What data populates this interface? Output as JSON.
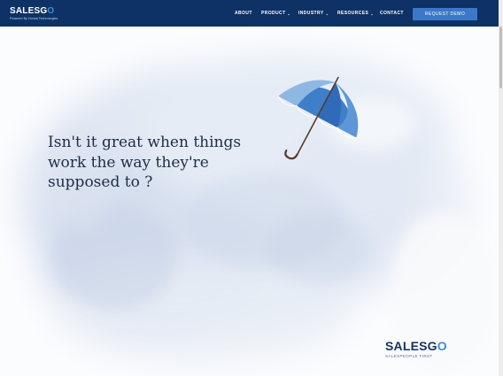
{
  "header": {
    "logo": {
      "brand_main": "SALESG",
      "brand_o": "O",
      "tagline": "Powered By Honda Technologies"
    },
    "nav": [
      {
        "label": "ABOUT",
        "has_dropdown": false
      },
      {
        "label": "PRODUCT",
        "has_dropdown": true
      },
      {
        "label": "INDUSTRY",
        "has_dropdown": true
      },
      {
        "label": "RESOURCES",
        "has_dropdown": true
      },
      {
        "label": "CONTACT",
        "has_dropdown": false
      }
    ],
    "cta_label": "REQUEST DEMO",
    "dropdown_caret": "⌄"
  },
  "hero": {
    "headline": "Isn't it great when things\nwork the way they're\nsupposed to ?"
  },
  "footer_brand": {
    "brand_main": "SALESG",
    "brand_o": "O",
    "tagline": "SALESPEOPLE FIRST"
  },
  "colors": {
    "header_bg": "#0e3266",
    "cta_bg": "#3b78c7",
    "accent": "#3b8fd8",
    "headline": "#1e2c48",
    "brand_dark": "#14325f"
  },
  "icons": {
    "umbrella": "umbrella-icon"
  }
}
